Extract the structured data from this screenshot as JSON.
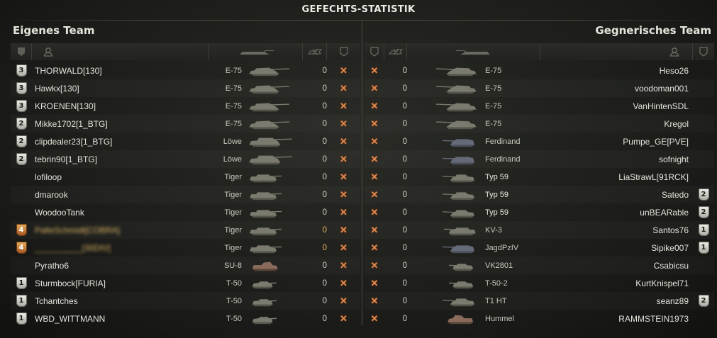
{
  "title": "GEFECHTS-STATISTIK",
  "left_team": "Eigenes Team",
  "right_team": "Gegnerisches Team",
  "colors": {
    "xmark": "#e08a50",
    "silver_badge": "#d8d8d0",
    "gold_badge": "#c07a38"
  },
  "header_icons": {
    "left": [
      "badge-icon",
      "player-icon",
      "tank-icon",
      "frags-icon",
      "status-icon"
    ],
    "right": [
      "status-icon",
      "frags-icon",
      "tank-icon",
      "player-icon",
      "badge-icon"
    ]
  },
  "left_rows": [
    {
      "badge": "3",
      "badge_type": "silver",
      "player": "THORWALD[130]",
      "tank": "E-75",
      "frags": "0",
      "status": "✕"
    },
    {
      "badge": "3",
      "badge_type": "silver",
      "player": "Hawkx[130]",
      "tank": "E-75",
      "frags": "0",
      "status": "✕"
    },
    {
      "badge": "3",
      "badge_type": "silver",
      "player": "KROENEN[130]",
      "tank": "E-75",
      "frags": "0",
      "status": "✕"
    },
    {
      "badge": "2",
      "badge_type": "silver",
      "player": "Mikke1702[1_BTG]",
      "tank": "E-75",
      "frags": "0",
      "status": "✕"
    },
    {
      "badge": "2",
      "badge_type": "silver",
      "player": "clipdealer23[1_BTG]",
      "tank": "Löwe",
      "frags": "0",
      "status": "✕"
    },
    {
      "badge": "2",
      "badge_type": "silver",
      "player": "tebrin90[1_BTG]",
      "tank": "Löwe",
      "frags": "0",
      "status": "✕"
    },
    {
      "badge": "",
      "badge_type": "none",
      "player": "lofiloop",
      "tank": "Tiger",
      "frags": "0",
      "status": "✕"
    },
    {
      "badge": "",
      "badge_type": "none",
      "player": "dmarook",
      "tank": "Tiger",
      "frags": "0",
      "status": "✕"
    },
    {
      "badge": "",
      "badge_type": "none",
      "player": "WoodooTank",
      "tank": "Tiger",
      "frags": "0",
      "status": "✕"
    },
    {
      "badge": "4",
      "badge_type": "gold",
      "player": "PalteSchmidt[COBRA]",
      "tank": "Tiger",
      "frags": "0",
      "status": "✕",
      "blurred": true
    },
    {
      "badge": "4",
      "badge_type": "gold",
      "player": "__________[30DIV]",
      "tank": "Tiger",
      "frags": "0",
      "status": "✕",
      "blurred": true
    },
    {
      "badge": "",
      "badge_type": "none",
      "player": "Pyratho6",
      "tank": "SU-8",
      "frags": "0",
      "status": "✕"
    },
    {
      "badge": "1",
      "badge_type": "silver",
      "player": "Sturmbock[FURIA]",
      "tank": "T-50",
      "frags": "0",
      "status": "✕"
    },
    {
      "badge": "1",
      "badge_type": "silver",
      "player": "Tchantches",
      "tank": "T-50",
      "frags": "0",
      "status": "✕"
    },
    {
      "badge": "1",
      "badge_type": "silver",
      "player": "WBD_WITTMANN",
      "tank": "T-50",
      "frags": "0",
      "status": "✕"
    }
  ],
  "right_rows": [
    {
      "badge": "",
      "badge_type": "none",
      "player": "Heso26",
      "tank": "E-75",
      "frags": "0",
      "status": "✕"
    },
    {
      "badge": "",
      "badge_type": "none",
      "player": "voodoman001",
      "tank": "E-75",
      "frags": "0",
      "status": "✕"
    },
    {
      "badge": "",
      "badge_type": "none",
      "player": "VanHintenSDL",
      "tank": "E-75",
      "frags": "0",
      "status": "✕"
    },
    {
      "badge": "",
      "badge_type": "none",
      "player": "Kregol",
      "tank": "E-75",
      "frags": "0",
      "status": "✕"
    },
    {
      "badge": "",
      "badge_type": "none",
      "player": "Pumpe_GE[PVE]",
      "tank": "Ferdinand",
      "frags": "0",
      "status": "✕"
    },
    {
      "badge": "",
      "badge_type": "none",
      "player": "sofnight",
      "tank": "Ferdinand",
      "frags": "0",
      "status": "✕"
    },
    {
      "badge": "",
      "badge_type": "none",
      "player": "LiaStrawL[91RCK]",
      "tank": "Typ 59",
      "frags": "0",
      "status": "✕",
      "bright": true
    },
    {
      "badge": "2",
      "badge_type": "silver",
      "player": "Satedo",
      "tank": "Typ 59",
      "frags": "0",
      "status": "✕",
      "bright": true
    },
    {
      "badge": "2",
      "badge_type": "silver",
      "player": "unBEARable",
      "tank": "Typ 59",
      "frags": "0",
      "status": "✕",
      "bright": true
    },
    {
      "badge": "1",
      "badge_type": "silver",
      "player": "Santos76",
      "tank": "KV-3",
      "frags": "0",
      "status": "✕"
    },
    {
      "badge": "1",
      "badge_type": "silver",
      "player": "Sipike007",
      "tank": "JagdPzIV",
      "frags": "0",
      "status": "✕"
    },
    {
      "badge": "",
      "badge_type": "none",
      "player": "Csabicsu",
      "tank": "VK2801",
      "frags": "0",
      "status": "✕"
    },
    {
      "badge": "",
      "badge_type": "none",
      "player": "KurtKnispel71",
      "tank": "T-50-2",
      "frags": "0",
      "status": "✕"
    },
    {
      "badge": "2",
      "badge_type": "silver",
      "player": "seanz89",
      "tank": "T1 HT",
      "frags": "0",
      "status": "✕"
    },
    {
      "badge": "",
      "badge_type": "none",
      "player": "RAMMSTEIN1973",
      "tank": "Hummel",
      "frags": "0",
      "status": "✕"
    }
  ]
}
